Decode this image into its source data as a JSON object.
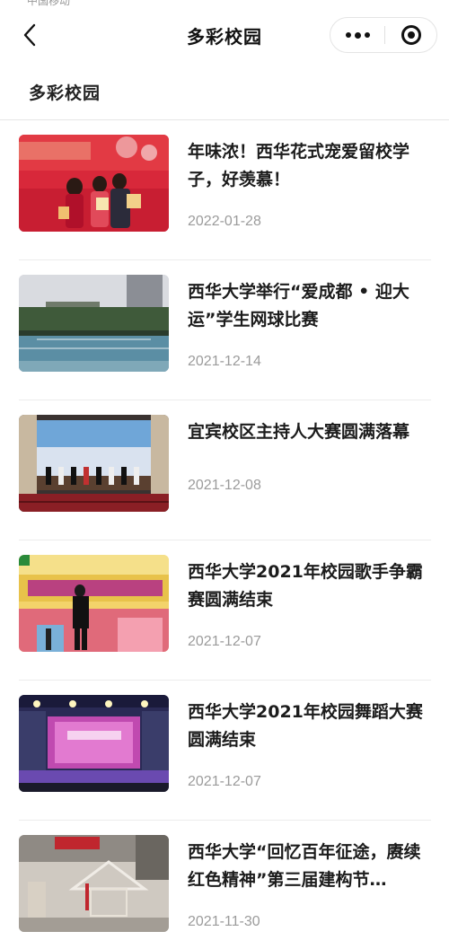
{
  "status_bar": {
    "carrier": "中国移动"
  },
  "nav": {
    "title": "多彩校园",
    "back_icon": "chevron-left-icon",
    "more_icon": "more-dots-icon",
    "close_icon": "miniprogram-close-icon"
  },
  "section": {
    "title": "多彩校园"
  },
  "news": [
    {
      "title": "年味浓！西华花式宠爱留校学子，好羡慕！",
      "date": "2022-01-28"
    },
    {
      "title": "西华大学举行“爱成都 • 迎大运”学生网球比赛",
      "date": "2021-12-14"
    },
    {
      "title": "宜宾校区主持人大赛圆满落幕",
      "date": "2021-12-08"
    },
    {
      "title": "西华大学2021年校园歌手争霸赛圆满结束",
      "date": "2021-12-07"
    },
    {
      "title": "西华大学2021年校园舞蹈大赛圆满结束",
      "date": "2021-12-07"
    },
    {
      "title": "西华大学“回忆百年征途，赓续红色精神”第三届建构节…",
      "date": "2021-11-30"
    }
  ],
  "colors": {
    "accent": "#111111",
    "divider": "#ececec",
    "date": "#9b9b9b"
  }
}
